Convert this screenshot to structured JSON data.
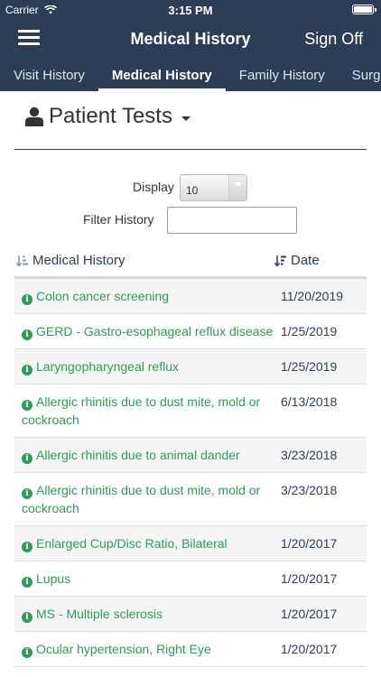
{
  "status_bar": {
    "carrier": "Carrier",
    "time": "3:15 PM"
  },
  "navbar": {
    "title": "Medical History",
    "sign_off": "Sign Off"
  },
  "tabs": [
    {
      "label": "Visit History",
      "active": false
    },
    {
      "label": "Medical History",
      "active": true
    },
    {
      "label": "Family History",
      "active": false
    },
    {
      "label": "Surg",
      "active": false
    }
  ],
  "section": {
    "title": "Patient Tests"
  },
  "controls": {
    "display_label": "Display",
    "display_value": "10",
    "filter_label": "Filter History",
    "filter_value": ""
  },
  "table": {
    "columns": [
      "Medical History",
      "Date"
    ],
    "rows": [
      {
        "condition": "Colon cancer screening",
        "date": "11/20/2019"
      },
      {
        "condition": "GERD - Gastro-esophageal reflux disease",
        "date": "1/25/2019"
      },
      {
        "condition": "Laryngopharyngeal reflux",
        "date": "1/25/2019"
      },
      {
        "condition": "Allergic rhinitis due to dust mite, mold or cockroach",
        "date": "6/13/2018"
      },
      {
        "condition": "Allergic rhinitis due to animal dander",
        "date": "3/23/2018"
      },
      {
        "condition": "Allergic rhinitis due to dust mite, mold or cockroach",
        "date": "3/23/2018"
      },
      {
        "condition": "Enlarged Cup/Disc Ratio, Bilateral",
        "date": "1/20/2017"
      },
      {
        "condition": "Lupus",
        "date": "1/20/2017"
      },
      {
        "condition": "MS - Multiple sclerosis",
        "date": "1/20/2017"
      },
      {
        "condition": "Ocular hypertension, Right Eye",
        "date": "1/20/2017"
      }
    ]
  },
  "colors": {
    "header": "#2c3e56",
    "link_green": "#2e9b58"
  },
  "icons": {
    "menu": "hamburger-icon",
    "person": "user-icon",
    "info": "info-icon",
    "sort": "sort-icon"
  }
}
